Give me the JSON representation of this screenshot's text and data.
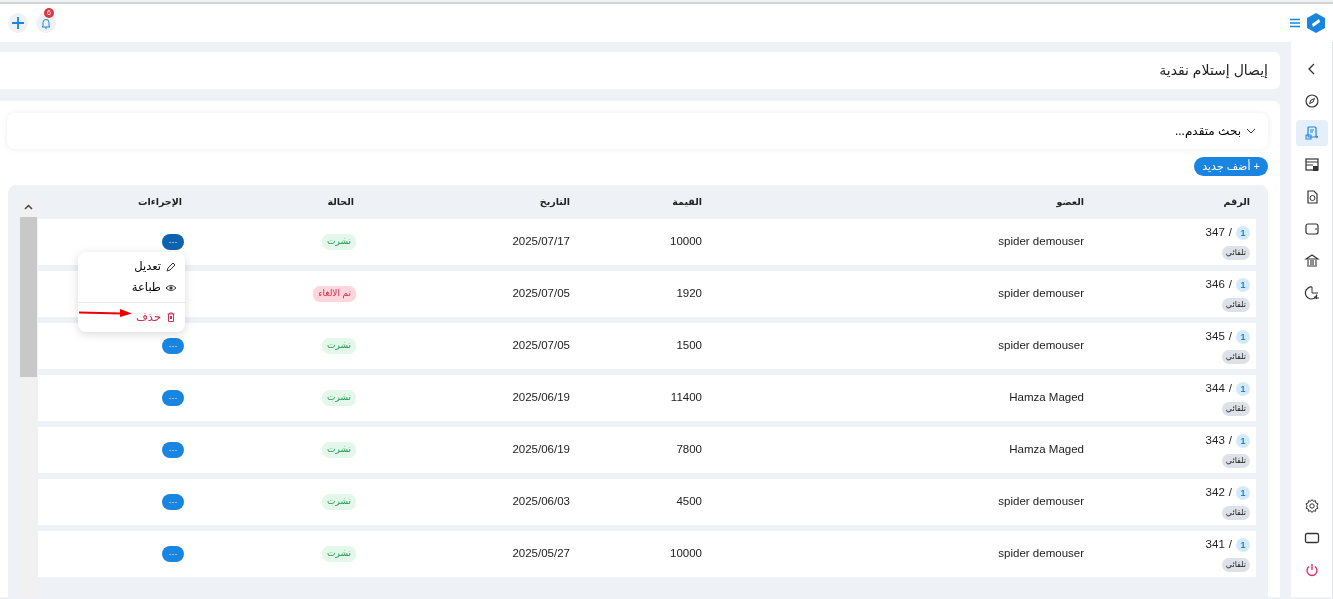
{
  "topbar": {
    "notification_count": "6"
  },
  "sidebar": {
    "items": [
      {
        "selected": false
      },
      {
        "selected": false
      },
      {
        "selected": true
      },
      {
        "selected": false
      },
      {
        "selected": false
      },
      {
        "selected": false
      },
      {
        "selected": false
      },
      {
        "selected": false
      }
    ],
    "bottom_items": [
      {
        "kind": "settings"
      },
      {
        "kind": "screen"
      },
      {
        "kind": "power"
      }
    ]
  },
  "page_title": "إيصال إستلام نقدية",
  "advanced_search": {
    "label": "بحث متقدم...",
    "expanded": false
  },
  "add_button": "+ أضف جديد",
  "table": {
    "columns": [
      "الرقم",
      "العضو",
      "القيمة",
      "التاريخ",
      "الحالة",
      "الإجراءات"
    ],
    "rows": [
      {
        "number": "347",
        "separator": "/",
        "copy": "1",
        "tag": "تلقائي",
        "member": "spider demouser",
        "amount": "10000",
        "date": "2025/07/17",
        "status": {
          "text": "نشرت",
          "kind": "published"
        },
        "action": "···",
        "menu_open": true
      },
      {
        "number": "346",
        "separator": "/",
        "copy": "1",
        "tag": "تلقائي",
        "member": "spider demouser",
        "amount": "1920",
        "date": "2025/07/05",
        "status": {
          "text": "تم الالغاء",
          "kind": "cancelled"
        },
        "menu_open": false
      },
      {
        "number": "345",
        "separator": "/",
        "copy": "1",
        "tag": "تلقائي",
        "member": "spider demouser",
        "amount": "1500",
        "date": "2025/07/05",
        "status": {
          "text": "نشرت",
          "kind": "published"
        },
        "action": "···",
        "menu_open": false
      },
      {
        "number": "344",
        "separator": "/",
        "copy": "1",
        "tag": "تلقائي",
        "member": "Hamza Maged",
        "amount": "11400",
        "date": "2025/06/19",
        "status": {
          "text": "نشرت",
          "kind": "published"
        },
        "action": "···",
        "menu_open": false
      },
      {
        "number": "343",
        "separator": "/",
        "copy": "1",
        "tag": "تلقائي",
        "member": "Hamza Maged",
        "amount": "7800",
        "date": "2025/06/19",
        "status": {
          "text": "نشرت",
          "kind": "published"
        },
        "action": "···",
        "menu_open": false
      },
      {
        "number": "342",
        "separator": "/",
        "copy": "1",
        "tag": "تلقائي",
        "member": "spider demouser",
        "amount": "4500",
        "date": "2025/06/03",
        "status": {
          "text": "نشرت",
          "kind": "published"
        },
        "action": "···",
        "menu_open": false
      },
      {
        "number": "341",
        "separator": "/",
        "copy": "1",
        "tag": "تلقائي",
        "member": "spider demouser",
        "amount": "10000",
        "date": "2025/05/27",
        "status": {
          "text": "نشرت",
          "kind": "published"
        },
        "action": "···",
        "menu_open": false
      }
    ]
  },
  "row_menu": {
    "items": [
      {
        "label": "تعديل",
        "kind": "edit"
      },
      {
        "label": "طباعة",
        "kind": "print"
      },
      {
        "label": "حذف",
        "kind": "delete"
      }
    ]
  }
}
